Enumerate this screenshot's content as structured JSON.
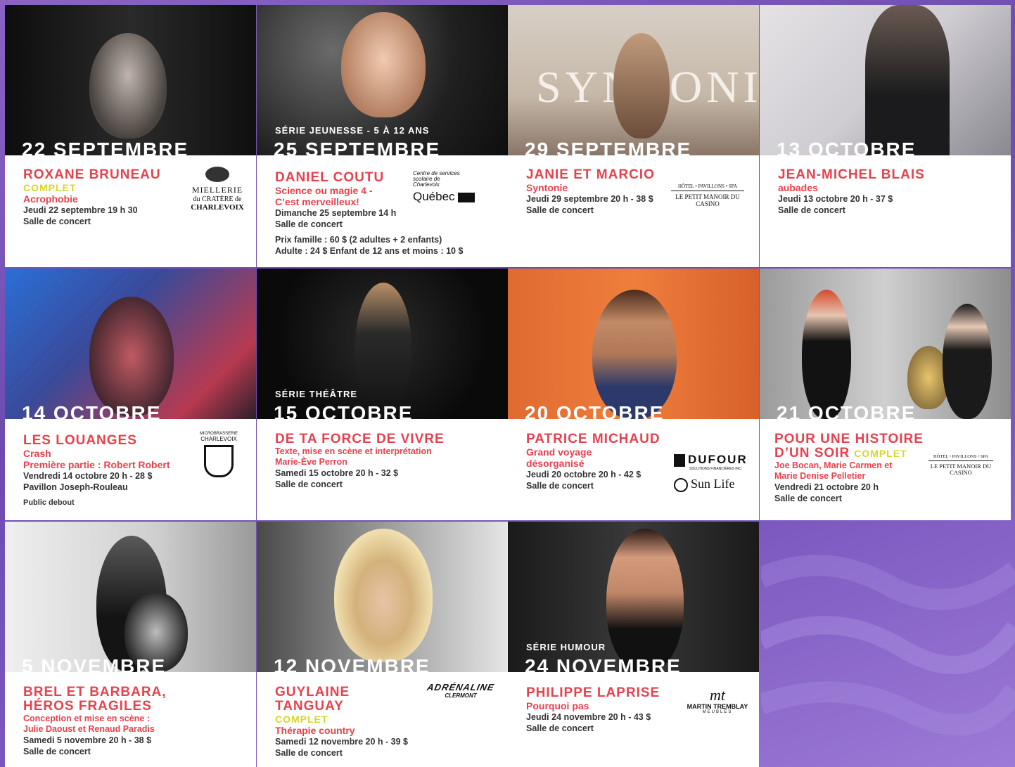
{
  "events": [
    {
      "date": "22 SEPTEMBRE",
      "series": "",
      "title": "ROXANE BRUNEAU",
      "title2": "",
      "complet": "COMPLET",
      "subtitle": [
        "Acrophobie"
      ],
      "details": [
        "Jeudi 22 septembre 19 h 30",
        "Salle de concert"
      ],
      "extra": [],
      "sponsor": {
        "name": "MIELLERIE",
        "line2": "du CRATÈRE de",
        "line3": "CHARLEVOIX"
      }
    },
    {
      "date": "25 SEPTEMBRE",
      "series": "SÉRIE JEUNESSE - 5 À 12 ANS",
      "title": "DANIEL COUTU",
      "title2": "",
      "complet": "",
      "subtitle": [
        "Science ou magie 4 -",
        "C’est merveilleux!"
      ],
      "details": [
        "Dimanche 25 septembre 14 h",
        "Salle de concert"
      ],
      "extra": [
        "Prix famille : 60 $ (2 adultes + 2 enfants)",
        "Adulte : 24 $  Enfant de 12 ans et moins : 10 $"
      ],
      "sponsor": {
        "name": "Québec",
        "line2": "Centre de services scolaire de Charlevoix",
        "line3": ""
      }
    },
    {
      "date": "29 SEPTEMBRE",
      "series": "",
      "title": "JANIE ET MARCIO",
      "title2": "",
      "complet": "",
      "subtitle": [
        "Syntonie"
      ],
      "details": [
        "Jeudi 29 septembre 20 h - 38 $",
        "Salle de concert"
      ],
      "extra": [],
      "sponsor": {
        "name": "LE PETIT MANOIR DU CASINO",
        "line2": "HÔTEL • PAVILLONS • SPA",
        "line3": ""
      },
      "photo_text": "SYNTONIE"
    },
    {
      "date": "13 OCTOBRE",
      "series": "",
      "title": "JEAN-MICHEL BLAIS",
      "title2": "",
      "complet": "",
      "subtitle": [
        "aubades"
      ],
      "details": [
        "Jeudi 13 octobre 20 h - 37 $",
        "Salle de concert"
      ],
      "extra": [],
      "sponsor": null
    },
    {
      "date": "14 OCTOBRE",
      "series": "",
      "title": "LES LOUANGES",
      "title2": "",
      "complet": "",
      "subtitle": [
        "Crash",
        "Première partie : Robert Robert"
      ],
      "details": [
        "Vendredi 14 octobre 20 h - 28 $",
        "Pavillon Joseph-Rouleau"
      ],
      "extra": [
        "Public debout"
      ],
      "sponsor": {
        "name": "CHARLEVOIX",
        "line2": "MICROBRASSERIE",
        "line3": ""
      }
    },
    {
      "date": "15 OCTOBRE",
      "series": "SÉRIE THÉÂTRE",
      "title": "DE TA FORCE DE VIVRE",
      "title2": "",
      "complet": "",
      "subtitle": [
        "Texte, mise en scène et interprétation",
        "Marie-Ève Perron"
      ],
      "details": [
        "Samedi 15 octobre 20 h - 32 $",
        "Salle de concert"
      ],
      "extra": [],
      "sponsor": null
    },
    {
      "date": "20 OCTOBRE",
      "series": "",
      "title": "PATRICE MICHAUD",
      "title2": "",
      "complet": "",
      "subtitle": [
        "Grand voyage",
        "désorganisé"
      ],
      "details": [
        "Jeudi 20 octobre 20 h - 42 $",
        "Salle de concert"
      ],
      "extra": [],
      "sponsor": {
        "name": "DUFOUR",
        "line2": "SOLUTIONS FINANCIÈRES INC.",
        "line3": "Sun Life"
      }
    },
    {
      "date": "21 OCTOBRE",
      "series": "",
      "title": "POUR UNE HISTOIRE",
      "title2": "D’UN SOIR",
      "complet": "COMPLET",
      "subtitle": [
        "Joe Bocan, Marie Carmen et",
        "Marie Denise Pelletier"
      ],
      "details": [
        "Vendredi 21 octobre 20 h",
        "Salle de concert"
      ],
      "extra": [],
      "sponsor": {
        "name": "LE PETIT MANOIR DU CASINO",
        "line2": "HÔTEL • PAVILLONS • SPA",
        "line3": ""
      }
    },
    {
      "date": "5 NOVEMBRE",
      "series": "",
      "title": "BREL ET BARBARA,",
      "title2": "HÉROS FRAGILES",
      "complet": "",
      "subtitle": [
        "Conception et mise en scène :",
        "Julie Daoust et Renaud Paradis"
      ],
      "details": [
        "Samedi 5 novembre 20 h - 38 $",
        "Salle de concert"
      ],
      "extra": [],
      "sponsor": null
    },
    {
      "date": "12 NOVEMBRE",
      "series": "",
      "title": "GUYLAINE",
      "title2": "TANGUAY",
      "complet": "COMPLET",
      "subtitle": [
        "Thérapie country"
      ],
      "details": [
        "Samedi 12 novembre 20 h - 39 $",
        "Salle de concert"
      ],
      "extra": [],
      "sponsor": {
        "name": "ADRÉNALINE",
        "line2": "CLERMONT",
        "line3": ""
      }
    },
    {
      "date": "24 NOVEMBRE",
      "series": "SÉRIE HUMOUR",
      "title": "PHILIPPE LAPRISE",
      "title2": "",
      "complet": "",
      "subtitle": [
        "Pourquoi pas"
      ],
      "details": [
        "Jeudi 24 novembre 20 h - 43 $",
        "Salle de concert"
      ],
      "extra": [],
      "sponsor": {
        "name": "MARTIN TREMBLAY",
        "line2": "MEUBLES",
        "line3": ""
      }
    }
  ],
  "colors": {
    "accent": "#e8414d",
    "complet": "#d6d62a",
    "background": "#7a58bf"
  }
}
